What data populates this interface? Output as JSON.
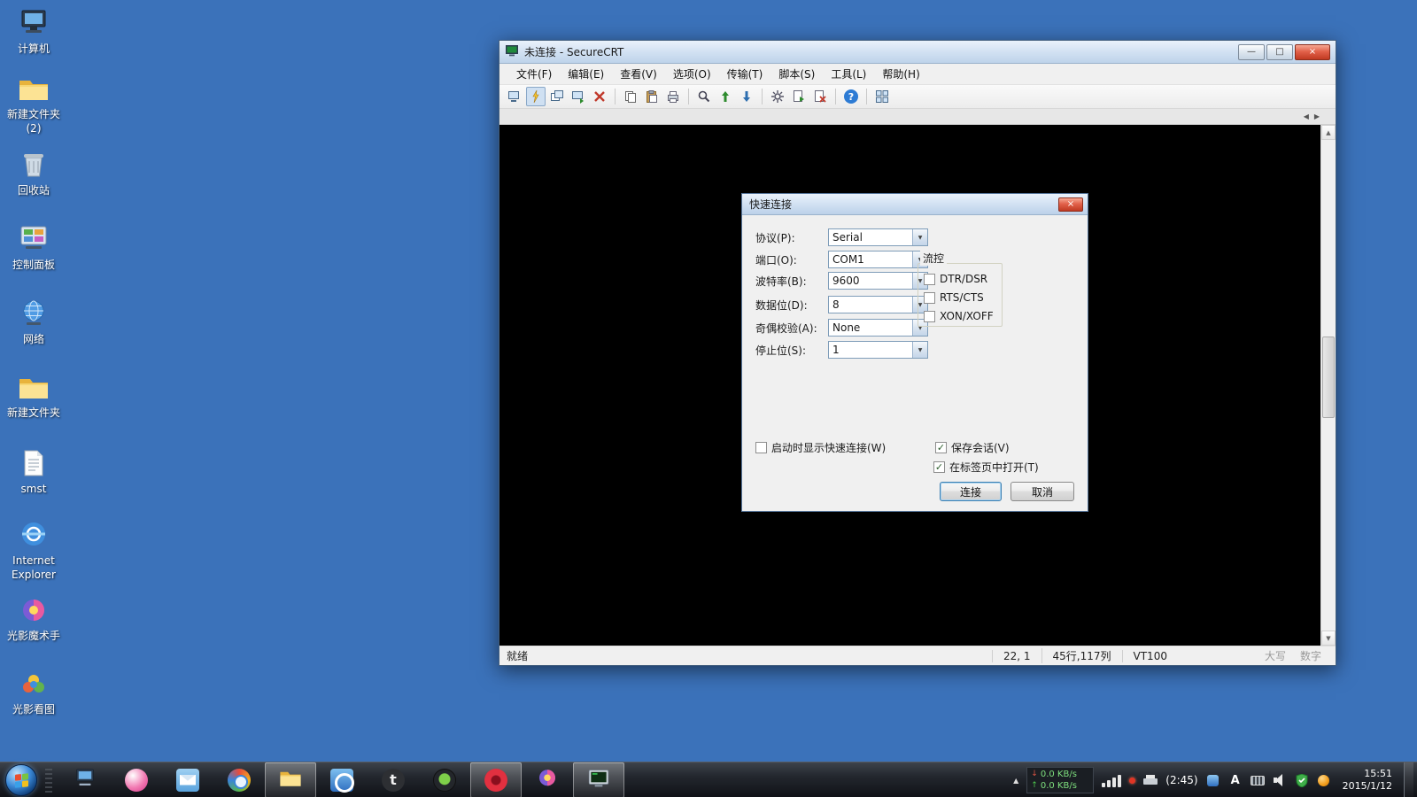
{
  "icons": {
    "dropdown_arrow": "▼",
    "check": "✓",
    "close": "×",
    "minimize": "—",
    "maximize": "□",
    "scroll_up": "▲",
    "scroll_down": "▼",
    "tab_left": "◀",
    "tab_right": "▶",
    "tray_expand": "▲",
    "net_down_arrow": "↓",
    "net_up_arrow": "↑",
    "help": "?",
    "letter_t": "t",
    "letter_a": "A"
  },
  "desktop": {
    "icons": [
      {
        "label": "计算机",
        "kind": "computer"
      },
      {
        "label": "新建文件夹(2)",
        "kind": "folder"
      },
      {
        "label": "回收站",
        "kind": "recycle-bin"
      },
      {
        "label": "控制面板",
        "kind": "control-panel"
      },
      {
        "label": "网络",
        "kind": "network"
      },
      {
        "label": "新建文件夹",
        "kind": "folder"
      },
      {
        "label": "smst",
        "kind": "file"
      },
      {
        "label": "Internet Explorer",
        "kind": "internet-explorer"
      },
      {
        "label": "光影魔术手",
        "kind": "photo-editor"
      },
      {
        "label": "光影看图",
        "kind": "photo-viewer"
      }
    ]
  },
  "window": {
    "title": "未连接 - SecureCRT",
    "menus": [
      "文件(F)",
      "编辑(E)",
      "查看(V)",
      "选项(O)",
      "传输(T)",
      "脚本(S)",
      "工具(L)",
      "帮助(H)"
    ],
    "toolbar_icons": [
      "connect",
      "quick-connect",
      "connect-in-tab",
      "reconnect",
      "disconnect",
      "copy",
      "paste",
      "print",
      "find",
      "upload",
      "download",
      "session-options",
      "run-script",
      "cancel-script",
      "help",
      "tile-windows"
    ],
    "status": {
      "ready": "就绪",
      "cursor": "22, 1",
      "size": "45行,117列",
      "emulation": "VT100",
      "caps": "大写",
      "num": "数字"
    }
  },
  "dialog": {
    "title": "快速连接",
    "fields": [
      {
        "label": "协议(P):",
        "value": "Serial"
      },
      {
        "label": "端口(O):",
        "value": "COM1"
      },
      {
        "label": "波特率(B):",
        "value": "9600"
      },
      {
        "label": "数据位(D):",
        "value": "8"
      },
      {
        "label": "奇偶校验(A):",
        "value": "None"
      },
      {
        "label": "停止位(S):",
        "value": "1"
      }
    ],
    "flow_group": {
      "title": "流控",
      "options": [
        {
          "label": "DTR/DSR",
          "checked": false
        },
        {
          "label": "RTS/CTS",
          "checked": false
        },
        {
          "label": "XON/XOFF",
          "checked": false
        }
      ]
    },
    "checkboxes": [
      {
        "label": "启动时显示快速连接(W)",
        "checked": false
      },
      {
        "label": "保存会话(V)",
        "checked": true
      },
      {
        "label": "在标签页中打开(T)",
        "checked": true
      }
    ],
    "buttons": {
      "connect": "连接",
      "cancel": "取消"
    }
  },
  "taskbar": {
    "apps": [
      {
        "name": "my-computer",
        "active": false
      },
      {
        "name": "image-tool",
        "active": false
      },
      {
        "name": "mail",
        "active": false
      },
      {
        "name": "browser",
        "active": false
      },
      {
        "name": "explorer-folder",
        "active": true
      },
      {
        "name": "internet-explorer",
        "active": false
      },
      {
        "name": "utorrent",
        "active": false
      },
      {
        "name": "media-player",
        "active": false
      },
      {
        "name": "player-app",
        "active": true
      },
      {
        "name": "photo-editor",
        "active": false
      },
      {
        "name": "securecrt",
        "active": true
      }
    ],
    "tray": {
      "net_down": "0.0 KB/s",
      "net_up": "0.0 KB/s",
      "badge": "(2:45)",
      "time": "15:51",
      "date": "2015/1/12"
    }
  }
}
